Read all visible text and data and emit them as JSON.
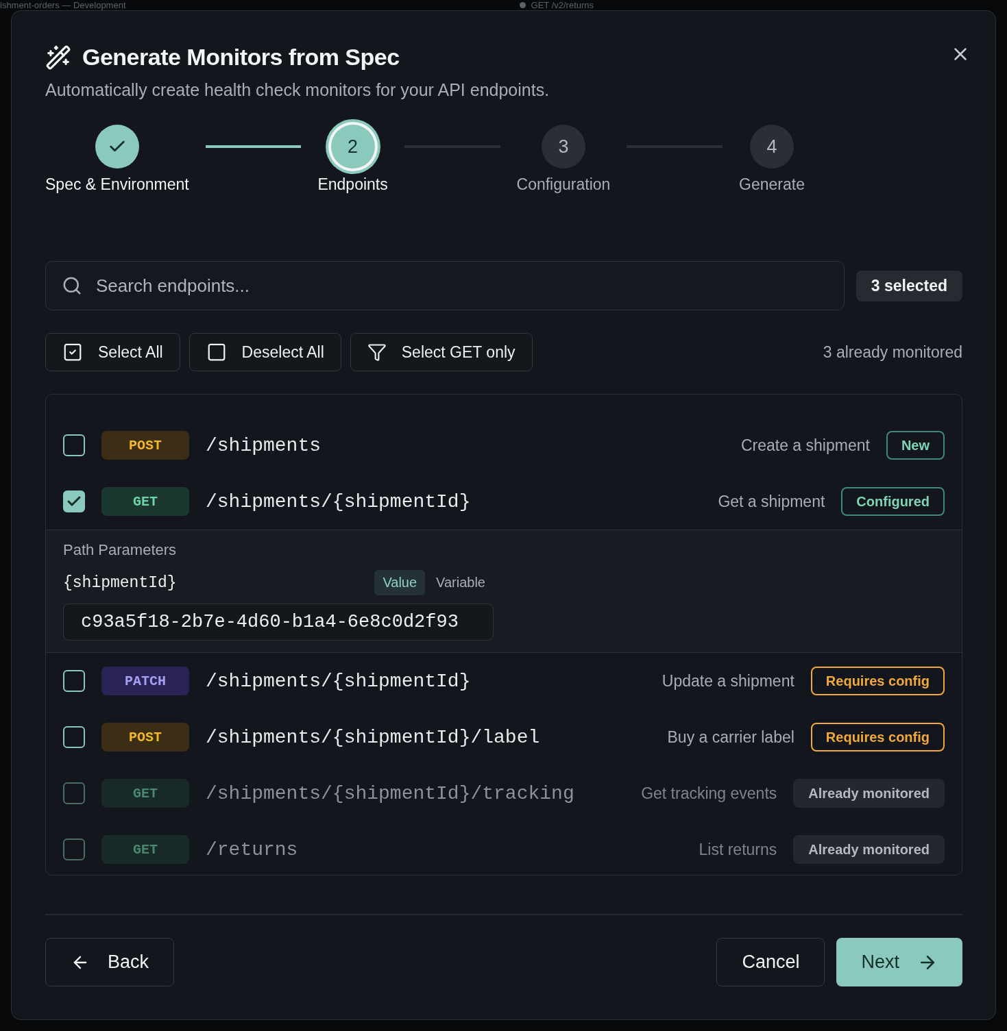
{
  "background": {
    "texts": [
      "ishment-orders — Development",
      "GET /v2/returns"
    ]
  },
  "dialog": {
    "title": "Generate Monitors from Spec",
    "subtitle": "Automatically create health check monitors for your API endpoints."
  },
  "steps": [
    {
      "label": "Spec & Environment",
      "done": true,
      "current": false
    },
    {
      "number": "2",
      "label": "Endpoints",
      "done": false,
      "current": true
    },
    {
      "number": "3",
      "label": "Configuration",
      "done": false,
      "current": false
    },
    {
      "number": "4",
      "label": "Generate",
      "done": false,
      "current": false
    }
  ],
  "search": {
    "placeholder": "Search endpoints..."
  },
  "selected_count": "3 selected",
  "actions": [
    {
      "kind": "select_all",
      "label": "Select All"
    },
    {
      "kind": "deselect_all",
      "label": "Deselect All"
    },
    {
      "kind": "filter",
      "label": "Select GET only"
    }
  ],
  "monitored_note": "3 already monitored",
  "endpoints": [
    {
      "method": "POST",
      "path": "/shipments",
      "description": "Create a shipment",
      "status": {
        "kind": "new",
        "label": "New"
      },
      "checked": false,
      "disabled": false
    },
    {
      "method": "GET",
      "path": "/shipments/{shipmentId}",
      "description": "Get a shipment",
      "status": {
        "kind": "configured",
        "label": "Configured"
      },
      "checked": true,
      "disabled": false,
      "params": {
        "title": "Path Parameters",
        "name": "{shipmentId}",
        "modes": [
          {
            "label": "Value",
            "selected": true
          },
          {
            "label": "Variable",
            "selected": false
          }
        ],
        "value": "c93a5f18-2b7e-4d60-b1a4-6e8c0d2f93"
      }
    },
    {
      "method": "PATCH",
      "path": "/shipments/{shipmentId}",
      "description": "Update a shipment",
      "status": {
        "kind": "requires",
        "label": "Requires config"
      },
      "checked": false,
      "disabled": false
    },
    {
      "method": "POST",
      "path": "/shipments/{shipmentId}/label",
      "description": "Buy a carrier label",
      "status": {
        "kind": "requires",
        "label": "Requires config"
      },
      "checked": false,
      "disabled": false
    },
    {
      "method": "GET",
      "path": "/shipments/{shipmentId}/tracking",
      "description": "Get tracking events",
      "status": {
        "kind": "monitored",
        "label": "Already monitored"
      },
      "checked": false,
      "disabled": true
    },
    {
      "method": "GET",
      "path": "/returns",
      "description": "List returns",
      "status": {
        "kind": "monitored",
        "label": "Already monitored"
      },
      "checked": false,
      "disabled": true
    }
  ],
  "footer": {
    "back": "Back",
    "cancel": "Cancel",
    "next": "Next"
  }
}
